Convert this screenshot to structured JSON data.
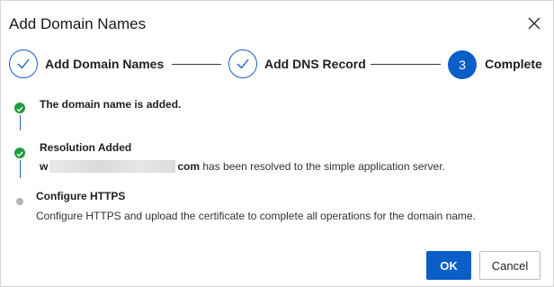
{
  "dialog": {
    "title": "Add Domain Names",
    "close_icon": "close-icon"
  },
  "steps": [
    {
      "label": "Add Domain Names",
      "state": "completed",
      "icon": "check-icon"
    },
    {
      "label": "Add DNS Record",
      "state": "completed",
      "icon": "check-icon"
    },
    {
      "label": "Complete",
      "state": "current",
      "number": "3"
    }
  ],
  "timeline": [
    {
      "title": "The domain name is added.",
      "status": "success",
      "icon": "check-icon"
    },
    {
      "title": "Resolution Added",
      "status": "success",
      "icon": "check-icon",
      "description_prefix": "w",
      "description_suffix": "com",
      "description_rest": " has been resolved to the simple application server."
    },
    {
      "title": "Configure HTTPS",
      "status": "pending",
      "description": "Configure HTTPS and upload the certificate to complete all operations for the domain name."
    }
  ],
  "footer": {
    "ok_label": "OK",
    "cancel_label": "Cancel"
  },
  "colors": {
    "primary": "#0a5ec7",
    "success": "#1f9d3c",
    "pending": "#b5b5b5"
  }
}
